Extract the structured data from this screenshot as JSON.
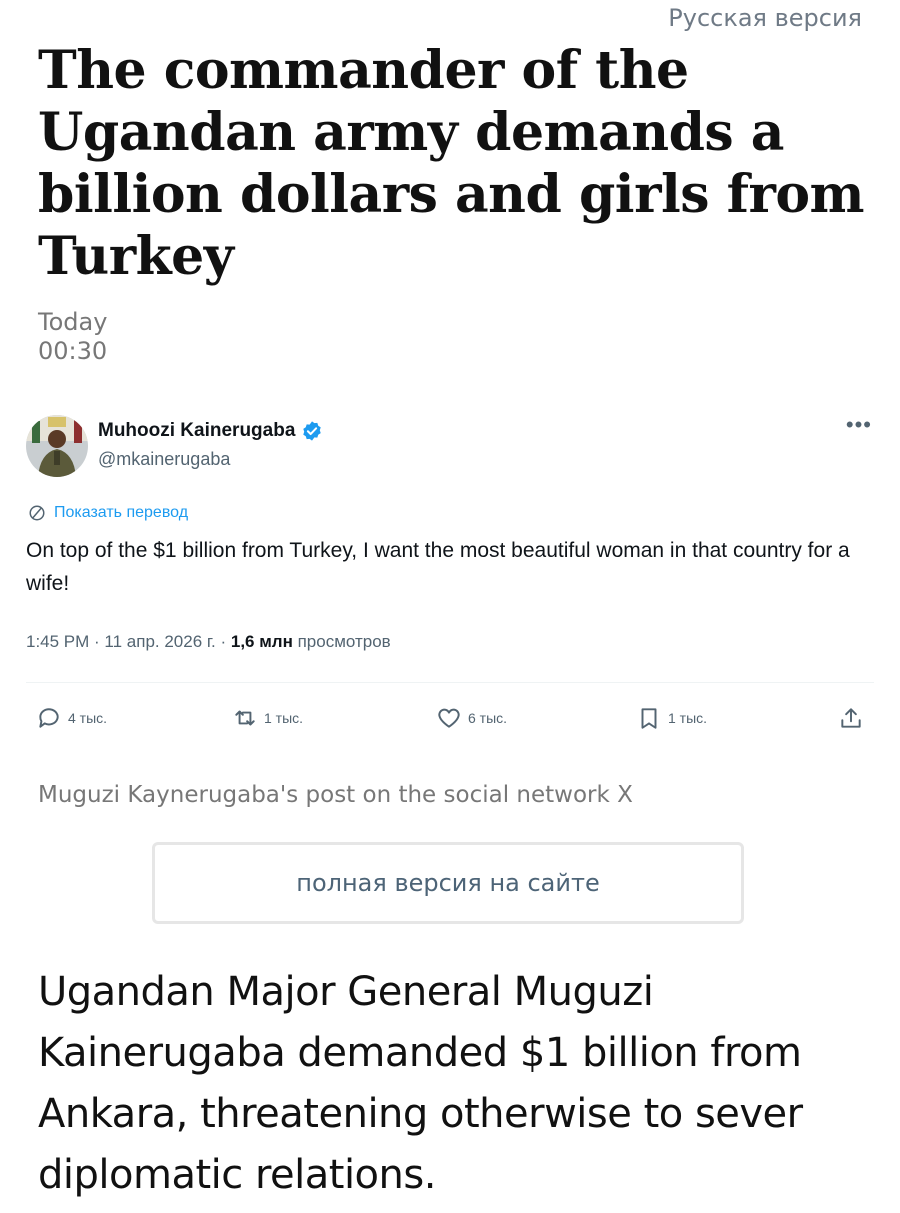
{
  "header": {
    "language_link": "Русская версия",
    "headline": "The commander of the Ugandan army demands a billion dollars and girls from Turkey",
    "date_day": "Today",
    "date_time": "00:30"
  },
  "tweet": {
    "author_name": "Muhoozi Kainerugaba",
    "handle": "@mkainerugaba",
    "more_icon": "more-icon",
    "translate_label": "Показать перевод",
    "text": "On top of the $1 billion from Turkey, I want the most beautiful woman in that country for a wife!",
    "meta_time": "1:45 PM · 11 апр. 2026 г. · ",
    "meta_views_count": "1,6 млн",
    "meta_views_label": " просмотров",
    "actions": {
      "replies": "4 тыс.",
      "reposts": "1 тыс.",
      "likes": "6 тыс.",
      "bookmarks": "1 тыс."
    },
    "colors": {
      "link": "#1d9bf0",
      "text": "#0f1419",
      "muted": "#536471"
    }
  },
  "caption": "Muguzi Kaynerugaba's post on the social network X",
  "full_version_button": "полная версия на сайте",
  "lead": "Ugandan Major General Muguzi Kainerugaba demanded $1 billion from Ankara, threatening otherwise to sever diplomatic relations."
}
